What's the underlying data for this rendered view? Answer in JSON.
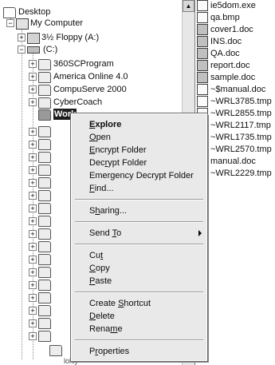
{
  "tree": {
    "items": [
      {
        "label": "Desktop",
        "icon": "desktop-icon"
      },
      {
        "label": "My Computer",
        "icon": "computer-icon"
      },
      {
        "label": "3½ Floppy (A:)",
        "icon": "floppy-icon"
      },
      {
        "label": "(C:)",
        "icon": "drive-icon"
      },
      {
        "label": "360SCProgram",
        "icon": "folder-icon"
      },
      {
        "label": "America Online 4.0",
        "icon": "folder-icon"
      },
      {
        "label": "CompuServe 2000",
        "icon": "folder-icon"
      },
      {
        "label": "CyberCoach",
        "icon": "folder-icon"
      },
      {
        "label": "Work",
        "icon": "folder-icon"
      }
    ],
    "partial_bottom": "lokiy"
  },
  "files": [
    {
      "name": "ie5dom.exe",
      "icon": "exe-icon"
    },
    {
      "name": "qa.bmp",
      "icon": "bitmap-icon"
    },
    {
      "name": "cover1.doc",
      "icon": "word-doc-icon"
    },
    {
      "name": "INS.doc",
      "icon": "word-doc-icon"
    },
    {
      "name": "QA.doc",
      "icon": "word-doc-icon"
    },
    {
      "name": "report.doc",
      "icon": "word-doc-icon"
    },
    {
      "name": "sample.doc",
      "icon": "word-doc-icon"
    },
    {
      "name": "~$manual.doc",
      "icon": "temp-file-icon"
    },
    {
      "name": "~WRL3785.tmp",
      "icon": "temp-file-icon"
    },
    {
      "name": "~WRL2855.tmp",
      "icon": "temp-file-icon"
    },
    {
      "name": "~WRL2117.tmp",
      "icon": "temp-file-icon"
    },
    {
      "name": "~WRL1735.tmp",
      "icon": "temp-file-icon"
    },
    {
      "name": "~WRL2570.tmp",
      "icon": "temp-file-icon"
    },
    {
      "name": "manual.doc",
      "icon": "word-doc-icon"
    },
    {
      "name": "~WRL2229.tmp",
      "icon": "temp-file-icon"
    }
  ],
  "menu": {
    "explore": {
      "pre": "",
      "key": "E",
      "post": "xplore"
    },
    "open": {
      "pre": "",
      "key": "O",
      "post": "pen"
    },
    "encrypt": {
      "pre": "",
      "key": "E",
      "post": "ncrypt Folder"
    },
    "decrypt": {
      "pre": "Dec",
      "key": "r",
      "post": "ypt Folder"
    },
    "emergency": {
      "pre": "Emergency Decrypt Folder",
      "key": "",
      "post": ""
    },
    "find": {
      "pre": "",
      "key": "F",
      "post": "ind..."
    },
    "sharing": {
      "pre": "S",
      "key": "h",
      "post": "aring..."
    },
    "sendto": {
      "pre": "Send ",
      "key": "T",
      "post": "o"
    },
    "cut": {
      "pre": "Cu",
      "key": "t",
      "post": ""
    },
    "copy": {
      "pre": "",
      "key": "C",
      "post": "opy"
    },
    "paste": {
      "pre": "",
      "key": "P",
      "post": "aste"
    },
    "shortcut": {
      "pre": "Create ",
      "key": "S",
      "post": "hortcut"
    },
    "delete": {
      "pre": "",
      "key": "D",
      "post": "elete"
    },
    "rename": {
      "pre": "Rena",
      "key": "m",
      "post": "e"
    },
    "properties": {
      "pre": "P",
      "key": "r",
      "post": "operties"
    }
  }
}
